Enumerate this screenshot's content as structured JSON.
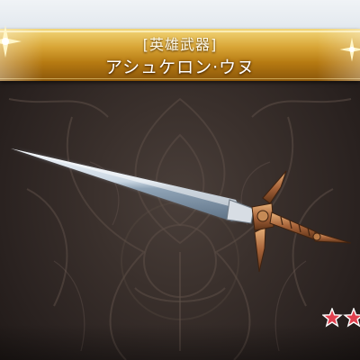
{
  "header": {
    "weapon_type": "[英雄武器]",
    "weapon_name": "アシュケロン·ウヌ"
  },
  "item": {
    "icon": "sword-icon",
    "rarity_stars_visible": 2
  },
  "colors": {
    "banner_gold": "#d8a536",
    "banner_text": "#ffffff",
    "background": "#3a302c",
    "star": "#e0404e"
  }
}
